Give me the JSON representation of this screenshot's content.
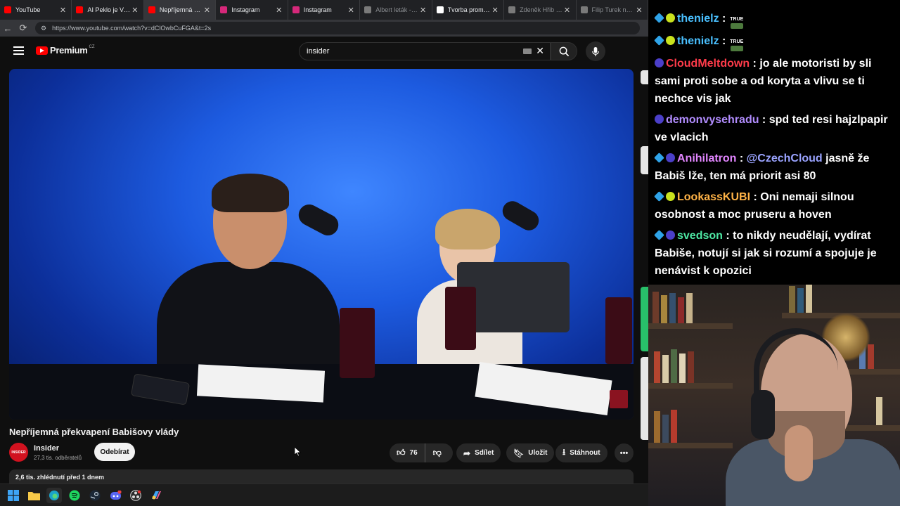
{
  "browser": {
    "tabs": [
      {
        "title": "YouTube",
        "favicon_color": "#ff0000",
        "active": false,
        "dim": false
      },
      {
        "title": "AI Peklo je Všude",
        "favicon_color": "#ff0000",
        "active": false,
        "dim": false
      },
      {
        "title": "Nepříjemná překv",
        "favicon_color": "#ff0000",
        "active": true,
        "dim": false
      },
      {
        "title": "Instagram",
        "favicon_color": "#d6287a",
        "active": false,
        "dim": false
      },
      {
        "title": "Instagram",
        "favicon_color": "#d6287a",
        "active": false,
        "dim": false
      },
      {
        "title": "Albert leták - Sup",
        "favicon_color": "#7a7a7a",
        "active": false,
        "dim": true
      },
      {
        "title": "Tvorba promo ob",
        "favicon_color": "#ffffff",
        "active": false,
        "dim": false
      },
      {
        "title": "Zdeněk Hřib na p",
        "favicon_color": "#7a7a7a",
        "active": false,
        "dim": true
      },
      {
        "title": "Filip Turek na pla",
        "favicon_color": "#7a7a7a",
        "active": false,
        "dim": true
      }
    ],
    "url": "https://www.youtube.com/watch?v=dClOwbCuFGA&t=2s"
  },
  "youtube": {
    "logo_text": "Premium",
    "logo_region": "CZ",
    "search_value": "insider",
    "video_title": "Nepříjemná překvapení Babišovy vlády",
    "channel": {
      "name": "Insider",
      "avatar_text": "INSIDER",
      "subscribers": "27,3 tis. odběratelů",
      "subscribe_label": "Odebírat"
    },
    "actions": {
      "likes": "76",
      "share_label": "Sdílet",
      "save_label": "Uložit",
      "download_label": "Stáhnout",
      "more_label": "•••"
    },
    "description_meta": "2,6 tis. zhlédnutí  před 1 dnem"
  },
  "chat": {
    "messages": [
      {
        "user": "thenielz",
        "color": "#4ac0ff",
        "badges": [
          "cube",
          "lime"
        ],
        "text": "",
        "true_badge": true
      },
      {
        "user": "thenielz",
        "color": "#4ac0ff",
        "badges": [
          "cube",
          "lime"
        ],
        "text": "",
        "true_badge": true
      },
      {
        "user": "CloudMeltdown",
        "color": "#ff3b4a",
        "badges": [
          "tb"
        ],
        "text": "jo ale motoristi by sli sami proti sobe a od koryta a vlivu se ti nechce vis jak"
      },
      {
        "user": "demonvysehradu",
        "color": "#b28dff",
        "badges": [
          "tb"
        ],
        "text": "spd ted resi hajzlpapir ve vlacich"
      },
      {
        "user": "Anihilatron",
        "color": "#e286ff",
        "badges": [
          "cube",
          "tb"
        ],
        "mention": "@CzechCloud",
        "text": "jasně že Babiš lže, ten má priorit asi 80"
      },
      {
        "user": "LookassKUBI",
        "color": "#ffb347",
        "badges": [
          "cube",
          "lime"
        ],
        "text": "Oni nemaji silnou osobnost a moc pruseru a hoven"
      },
      {
        "user": "svedson",
        "color": "#4ee8a4",
        "badges": [
          "cube",
          "tb"
        ],
        "text": "to nikdy neudělají, vydírat Babiše, notují si jak si rozumí a spojuje je nenávist k opozici"
      }
    ],
    "true_badge_text": "TRUE"
  },
  "taskbar": {
    "icons": [
      "windows-start-icon",
      "file-explorer-icon",
      "edge-browser-icon",
      "spotify-icon",
      "steam-icon",
      "discord-icon",
      "obs-icon",
      "copilot-icon"
    ]
  }
}
